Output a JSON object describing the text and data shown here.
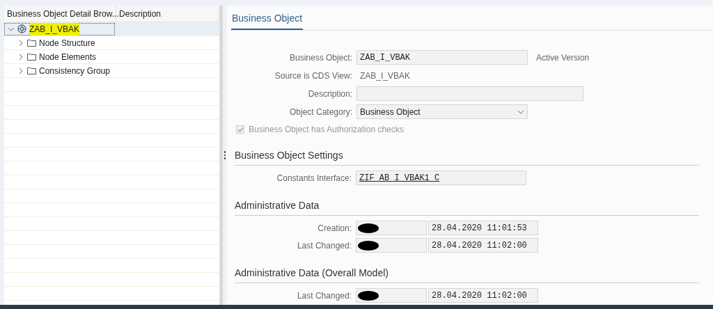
{
  "tree": {
    "columns": [
      "Business Object Detail Brow...",
      "Description"
    ],
    "items": [
      {
        "label": "ZAB_I_VBAK",
        "kind": "object",
        "selected": true,
        "expanded": true,
        "highlighted": true,
        "children": [
          {
            "label": "Node Structure",
            "kind": "folder",
            "selected": false,
            "expanded": false,
            "highlighted": false
          },
          {
            "label": "Node Elements",
            "kind": "folder",
            "selected": false,
            "expanded": false,
            "highlighted": false
          },
          {
            "label": "Consistency Group",
            "kind": "folder",
            "selected": false,
            "expanded": false,
            "highlighted": false
          }
        ]
      }
    ]
  },
  "tabs": [
    {
      "label": "Business Object",
      "selected": true
    }
  ],
  "form": {
    "business_object": {
      "label": "Business Object:",
      "value": "ZAB_I_VBAK",
      "note": "Active Version"
    },
    "source": {
      "label": "Source is CDS View:",
      "value": "ZAB_I_VBAK"
    },
    "description": {
      "label": "Description:"
    },
    "category": {
      "label": "Object Category:",
      "value": "Business Object"
    },
    "authorization": {
      "label": "Business Object has Authorization checks",
      "checked": true,
      "disabled": true
    }
  },
  "sections": [
    {
      "title": "Business Object Settings",
      "rows": [
        {
          "kind": "link",
          "label": "Constants Interface:",
          "value": "ZIF_AB_I_VBAK1_C"
        }
      ]
    },
    {
      "title": "Administrative Data",
      "rows": [
        {
          "kind": "admin",
          "label": "Creation:",
          "user_redacted": true,
          "timestamp": "28.04.2020 11:01:53"
        },
        {
          "kind": "admin",
          "label": "Last Changed:",
          "user_redacted": true,
          "timestamp": "28.04.2020 11:02:00"
        }
      ]
    },
    {
      "title": "Administrative Data (Overall Model)",
      "rows": [
        {
          "kind": "admin",
          "label": "Last Changed:",
          "user_redacted": true,
          "timestamp": "28.04.2020 11:02:00"
        }
      ]
    }
  ]
}
